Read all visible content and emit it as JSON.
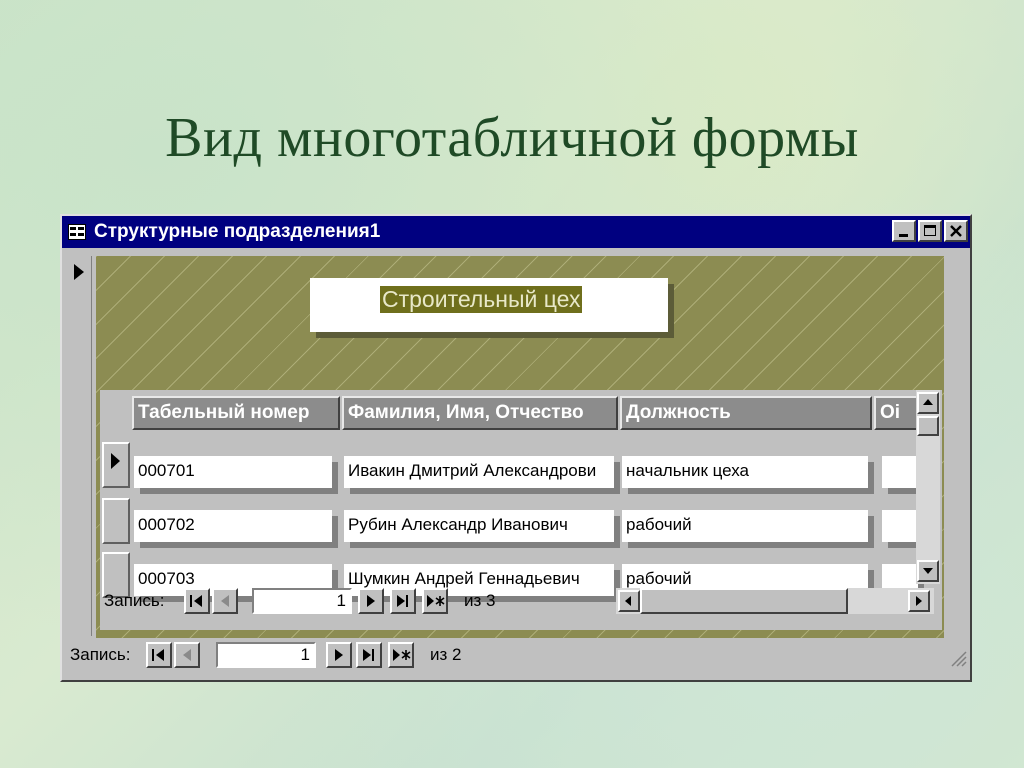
{
  "slide": {
    "title": "Вид многотабличной формы"
  },
  "window": {
    "title": "Структурные подразделения1",
    "icons": {
      "system": "form-icon",
      "minimize": "minimize-icon",
      "maximize": "maximize-icon",
      "close": "close-icon"
    }
  },
  "main_form": {
    "header_value": "Строительный цех",
    "nav": {
      "label": "Запись:",
      "current": "1",
      "total_label": "из 2"
    }
  },
  "subform": {
    "columns": [
      "Табельный номер",
      "Фамилия, Имя, Отчество",
      "Должность",
      "Оі"
    ],
    "rows": [
      {
        "id": "000701",
        "name": "Ивакин Дмитрий Александрови",
        "position": "начальник цеха"
      },
      {
        "id": "000702",
        "name": "Рубин Александр Иванович",
        "position": "рабочий"
      },
      {
        "id": "000703",
        "name": "Шумкин Андрей Геннадьевич",
        "position": "рабочий"
      }
    ],
    "nav": {
      "label": "Запись:",
      "current": "1",
      "total_label": "из 3"
    }
  },
  "colors": {
    "titlebar": "#000080",
    "form_background": "#8c8c52",
    "highlight": "#6f6f1c"
  }
}
